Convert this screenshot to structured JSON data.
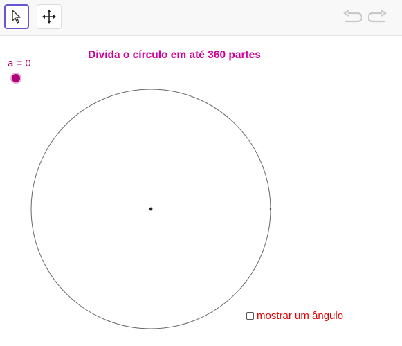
{
  "toolbar": {
    "tools": [
      {
        "name": "move-graphics",
        "icon": "arrow-pointer-icon",
        "selected": true
      },
      {
        "name": "translate",
        "icon": "move-arrows-icon",
        "selected": false
      }
    ],
    "undo_icon": "undo-icon",
    "redo_icon": "redo-icon"
  },
  "title": "Divida o círculo em até 360 partes",
  "slider": {
    "label": "a = 0",
    "value": 0,
    "min": 0,
    "max": 360,
    "color": "#b0007a"
  },
  "checkbox": {
    "label": "mostrar um ângulo",
    "checked": false,
    "color": "#e60000"
  },
  "colors": {
    "title": "#cc0099",
    "accent": "#6557d2"
  }
}
